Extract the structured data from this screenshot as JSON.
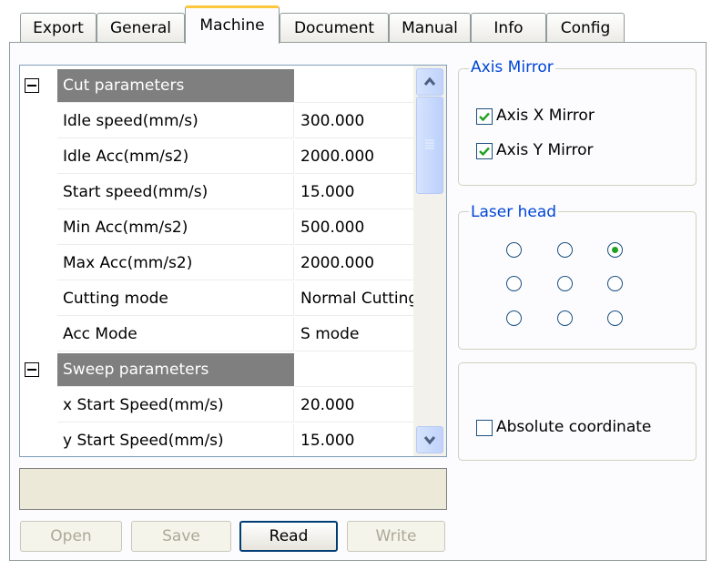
{
  "tabs": [
    {
      "label": "Export"
    },
    {
      "label": "General"
    },
    {
      "label": "Machine"
    },
    {
      "label": "Document"
    },
    {
      "label": "Manual"
    },
    {
      "label": "Info"
    },
    {
      "label": "Config"
    }
  ],
  "active_tab": "Machine",
  "grid": {
    "rows": [
      {
        "kind": "group",
        "name": "Cut parameters",
        "value": ""
      },
      {
        "kind": "item",
        "name": "Idle speed(mm/s)",
        "value": "300.000"
      },
      {
        "kind": "item",
        "name": "Idle Acc(mm/s2)",
        "value": "2000.000"
      },
      {
        "kind": "item",
        "name": "Start speed(mm/s)",
        "value": "15.000"
      },
      {
        "kind": "item",
        "name": "Min Acc(mm/s2)",
        "value": "500.000"
      },
      {
        "kind": "item",
        "name": "Max Acc(mm/s2)",
        "value": "2000.000"
      },
      {
        "kind": "item",
        "name": "Cutting mode",
        "value": "Normal Cutting"
      },
      {
        "kind": "item",
        "name": "Acc Mode",
        "value": "S mode"
      },
      {
        "kind": "group",
        "name": "Sweep parameters",
        "value": ""
      },
      {
        "kind": "item",
        "name": "x Start Speed(mm/s)",
        "value": "20.000"
      },
      {
        "kind": "item",
        "name": "y Start Speed(mm/s)",
        "value": "15.000"
      }
    ]
  },
  "status_text": "",
  "buttons": {
    "open": "Open",
    "save": "Save",
    "read": "Read",
    "write": "Write"
  },
  "axis_mirror": {
    "title": "Axis Mirror",
    "x_label": "Axis X Mirror",
    "y_label": "Axis Y Mirror",
    "x_checked": true,
    "y_checked": true
  },
  "laser_head": {
    "title": "Laser head",
    "selected_row": 0,
    "selected_col": 2
  },
  "absolute": {
    "label": "Absolute coordinate",
    "checked": false
  }
}
